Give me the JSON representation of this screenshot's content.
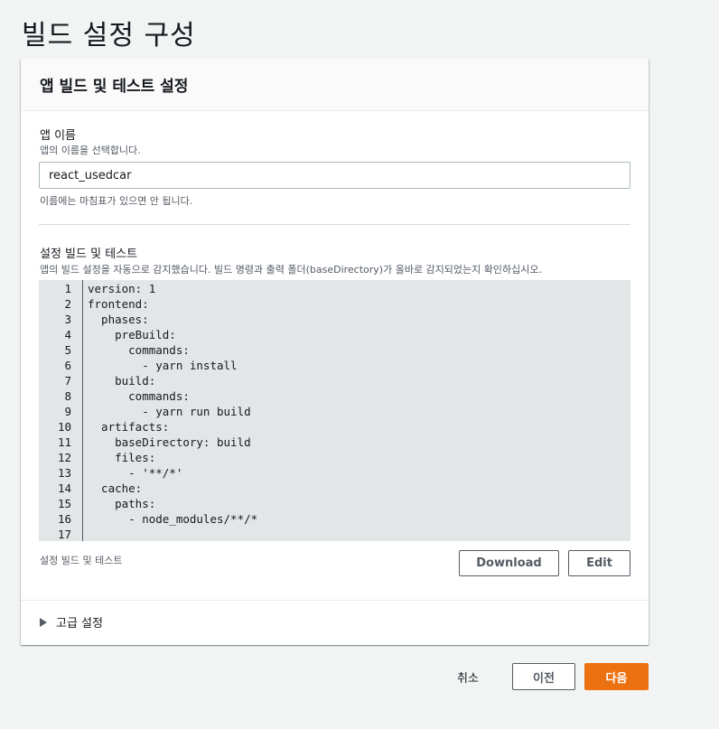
{
  "page": {
    "title": "빌드 설정 구성"
  },
  "card": {
    "header": "앱 빌드 및 테스트 설정",
    "app_name": {
      "label": "앱 이름",
      "description": "앱의 이름을 선택합니다.",
      "value": "react_usedcar",
      "hint": "이름에는 마침표가 있으면 안 됩니다."
    },
    "build_settings": {
      "label": "설정 빌드 및 테스트",
      "description": "앱의 빌드 설정을 자동으로 감지했습니다. 빌드 명령과 출력 폴더(baseDirectory)가 올바로 감지되었는지 확인하십시오.",
      "code_lines": [
        {
          "num": "1",
          "text": "version: 1"
        },
        {
          "num": "2",
          "text": "frontend:"
        },
        {
          "num": "3",
          "text": "  phases:"
        },
        {
          "num": "4",
          "text": "    preBuild:"
        },
        {
          "num": "5",
          "text": "      commands:"
        },
        {
          "num": "6",
          "text": "        - yarn install"
        },
        {
          "num": "7",
          "text": "    build:"
        },
        {
          "num": "8",
          "text": "      commands:"
        },
        {
          "num": "9",
          "text": "        - yarn run build"
        },
        {
          "num": "10",
          "text": "  artifacts:"
        },
        {
          "num": "11",
          "text": "    baseDirectory: build"
        },
        {
          "num": "12",
          "text": "    files:"
        },
        {
          "num": "13",
          "text": "      - '**/*'"
        },
        {
          "num": "14",
          "text": "  cache:"
        },
        {
          "num": "15",
          "text": "    paths:"
        },
        {
          "num": "16",
          "text": "      - node_modules/**/*"
        },
        {
          "num": "17",
          "text": ""
        }
      ],
      "caption": "설정 빌드 및 테스트",
      "download_label": "Download",
      "edit_label": "Edit"
    },
    "advanced": {
      "label": "고급 설정",
      "icon": "caret-right-icon"
    }
  },
  "actions": {
    "cancel_label": "취소",
    "previous_label": "이전",
    "next_label": "다음"
  },
  "colors": {
    "primary": "#ec7211",
    "code_background": "#e3e6e6",
    "page_background": "#f2f3f3"
  }
}
